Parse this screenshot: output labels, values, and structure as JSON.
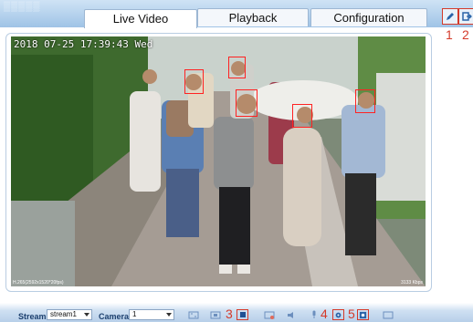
{
  "tabs": [
    {
      "label": "Live Video",
      "active": true
    },
    {
      "label": "Playback",
      "active": false
    },
    {
      "label": "Configuration",
      "active": false
    }
  ],
  "top_buttons": [
    {
      "icon": "edit-icon",
      "marker": "1"
    },
    {
      "icon": "exit-icon",
      "marker": "2"
    }
  ],
  "video": {
    "osd_timestamp": "2018 07-25 17:39:43 Wed",
    "codec_info": "H.265(2592x1520*20fps)",
    "bitrate": "3133 Kbps"
  },
  "bottom": {
    "stream_label": "Stream",
    "stream_value": "stream1",
    "camera_label": "Camera",
    "camera_value": "1",
    "markers": {
      "m3": "3",
      "m4": "4",
      "m5": "5"
    }
  },
  "colors": {
    "accent_red": "#d43a2a",
    "bar_blue": "#9fc3e6",
    "face_box": "#ff2222"
  }
}
